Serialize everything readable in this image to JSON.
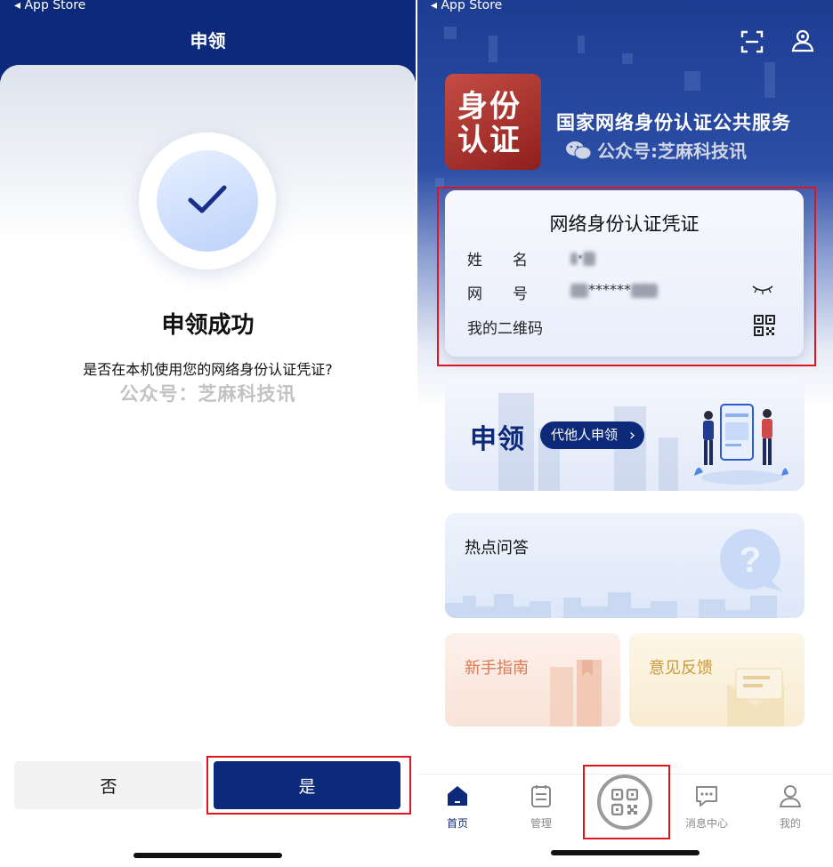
{
  "colors": {
    "navy": "#0d2a7a",
    "highlight_red": "#e0141e",
    "logo_red": "#b0312c"
  },
  "left": {
    "statusbar": "◂ App Store",
    "nav_title": "申领",
    "success_title": "申领成功",
    "question": "是否在本机使用您的网络身份认证凭证?",
    "watermark": "公众号：芝麻科技讯",
    "buttons": {
      "no": "否",
      "yes": "是"
    },
    "icons": {
      "success": "check-icon"
    }
  },
  "right": {
    "statusbar": "◂ App Store",
    "logo_lines": [
      "身份",
      "认证"
    ],
    "brand_title": "国家网络身份认证公共服务",
    "watermark": "公众号:芝麻科技讯",
    "credential": {
      "title": "网络身份认证凭证",
      "name_label": "姓　　名",
      "name_value": "*",
      "id_label": "网　　号",
      "id_value": "******",
      "qr_label": "我的二维码"
    },
    "apply": {
      "title": "申领",
      "proxy_button": "代他人申领",
      "proxy_chevron": "›"
    },
    "faq": {
      "title": "热点问答"
    },
    "guide": {
      "title": "新手指南"
    },
    "feedback": {
      "title": "意见反馈"
    },
    "tabs": [
      {
        "label": "首页",
        "icon": "home-icon"
      },
      {
        "label": "管理",
        "icon": "clipboard-icon"
      },
      {
        "label": "",
        "icon": "qr-code-icon"
      },
      {
        "label": "消息中心",
        "icon": "message-icon"
      },
      {
        "label": "我的",
        "icon": "person-icon"
      }
    ]
  }
}
